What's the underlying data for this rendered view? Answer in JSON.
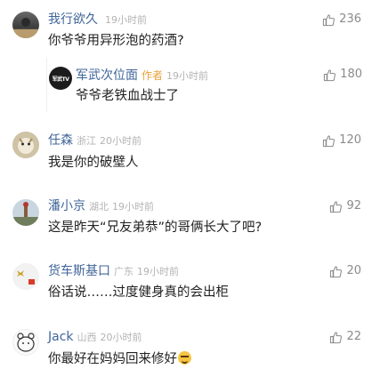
{
  "comments": [
    {
      "user": "我行欲久",
      "location": "",
      "time": "19小时前",
      "text": "你爷爷用异形泡的药酒?",
      "likes": "236",
      "reply": {
        "user": "军武次位面",
        "tag": "作者",
        "time": "19小时前",
        "text": "爷爷老铁血战士了",
        "likes": "180",
        "avatar_text": "军武TV"
      }
    },
    {
      "user": "任森",
      "location": "浙江",
      "time": "20小时前",
      "text": "我是你的破壁人",
      "likes": "120"
    },
    {
      "user": "潘小京",
      "location": "湖北",
      "time": "19小时前",
      "text": "这是昨天“兄友弟恭”的哥俩长大了吧?",
      "likes": "92"
    },
    {
      "user": "货车斯基口",
      "location": "广东",
      "time": "19小时前",
      "text": "俗话说……过度健身真的会出柜",
      "likes": "20"
    },
    {
      "user": "Jack",
      "location": "山西",
      "time": "20小时前",
      "text": "你最好在妈妈回来修好",
      "likes": "22"
    }
  ],
  "colors": {
    "username": "#406599",
    "meta": "#b3b3b3",
    "author_tag": "#e9a23b",
    "text": "#222222"
  },
  "icons": {
    "like": "thumbs-up-icon",
    "emoji": "grinning-emoji-icon"
  }
}
